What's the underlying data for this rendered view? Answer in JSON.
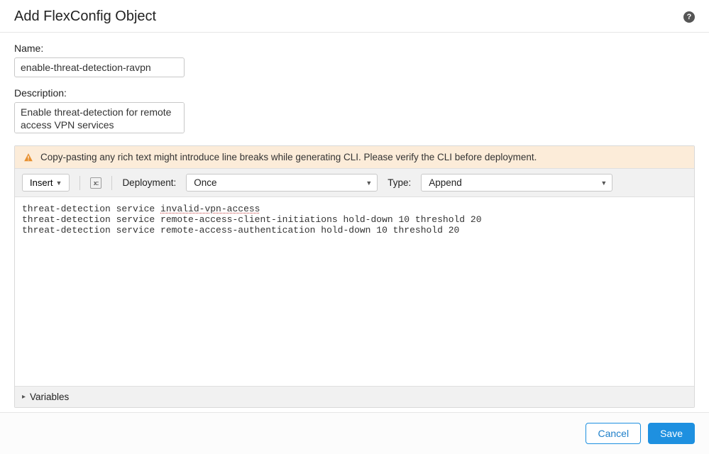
{
  "dialog": {
    "title": "Add FlexConfig Object"
  },
  "form": {
    "name_label": "Name:",
    "name_value": "enable-threat-detection-ravpn",
    "description_label": "Description:",
    "description_value": "Enable threat-detection for remote access VPN services"
  },
  "warning": {
    "text": "Copy-pasting any rich text might introduce line breaks while generating CLI. Please verify the CLI before deployment."
  },
  "toolbar": {
    "insert_label": "Insert",
    "deployment_label": "Deployment:",
    "deployment_value": "Once",
    "type_label": "Type:",
    "type_value": "Append"
  },
  "cli": {
    "line1_a": "threat-detection service ",
    "line1_b": "invalid-vpn-access",
    "line2": "threat-detection service remote-access-client-initiations hold-down 10 threshold 20",
    "line3": "threat-detection service remote-access-authentication hold-down 10 threshold 20"
  },
  "variables": {
    "label": "Variables"
  },
  "footer": {
    "cancel": "Cancel",
    "save": "Save"
  }
}
